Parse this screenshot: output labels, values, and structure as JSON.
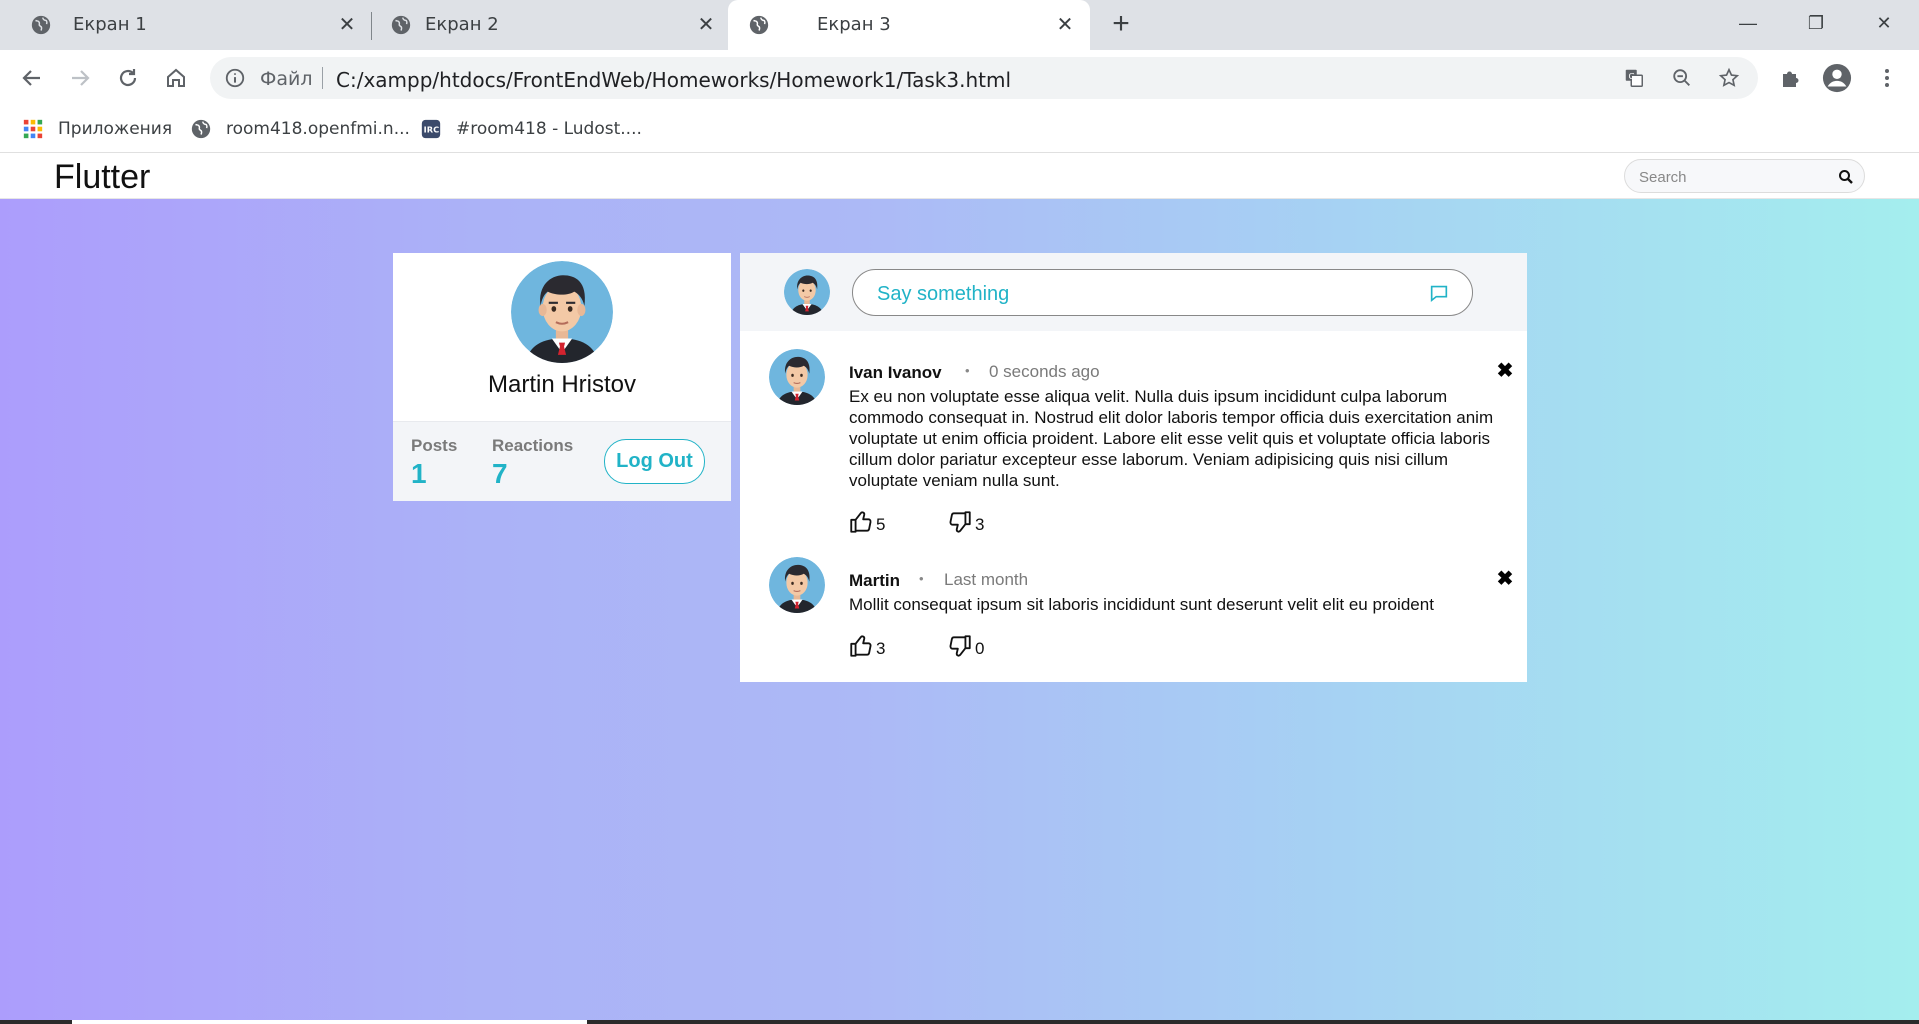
{
  "browser": {
    "tabs": [
      {
        "title": "Екран 1"
      },
      {
        "title": "Екран 2"
      },
      {
        "title": "Екран 3"
      }
    ],
    "address": {
      "scheme_label": "Файл",
      "url": "C:/xampp/htdocs/FrontEndWeb/Homeworks/Homework1/Task3.html"
    },
    "bookmarks": [
      {
        "label": "Приложения",
        "icon": "apps-grid-icon"
      },
      {
        "label": "room418.openfmi.n...",
        "icon": "globe-icon"
      },
      {
        "label": "#room418 - Ludost....",
        "icon": "irc-icon"
      }
    ]
  },
  "page": {
    "brand": "Flutter",
    "search": {
      "placeholder": "Search"
    },
    "profile": {
      "name": "Martin Hristov",
      "posts_label": "Posts",
      "posts_value": "1",
      "reactions_label": "Reactions",
      "reactions_value": "7",
      "logout_label": "Log Out"
    },
    "composer": {
      "placeholder": "Say something"
    },
    "posts": [
      {
        "author": "Ivan Ivanov",
        "separator": "•",
        "time": "0 seconds ago",
        "text": "Ex eu non voluptate esse aliqua velit. Nulla duis ipsum incididunt culpa laborum commodo consequat in. Nostrud elit dolor laboris tempor officia duis exercitation anim voluptate ut enim officia proident. Labore elit esse velit quis et voluptate officia laboris cillum dolor pariatur excepteur esse laborum. Veniam adipisicing quis nisi cillum voluptate veniam nulla sunt.",
        "likes": "5",
        "dislikes": "3"
      },
      {
        "author": "Martin",
        "separator": "•",
        "time": "Last month",
        "text": "Mollit consequat ipsum sit laboris incididunt sunt deserunt velit elit eu proident",
        "likes": "3",
        "dislikes": "0"
      }
    ]
  },
  "colors": {
    "accent": "#21b3c7",
    "gradient_start": "#ac9dfc",
    "gradient_end": "#a4eeee"
  }
}
